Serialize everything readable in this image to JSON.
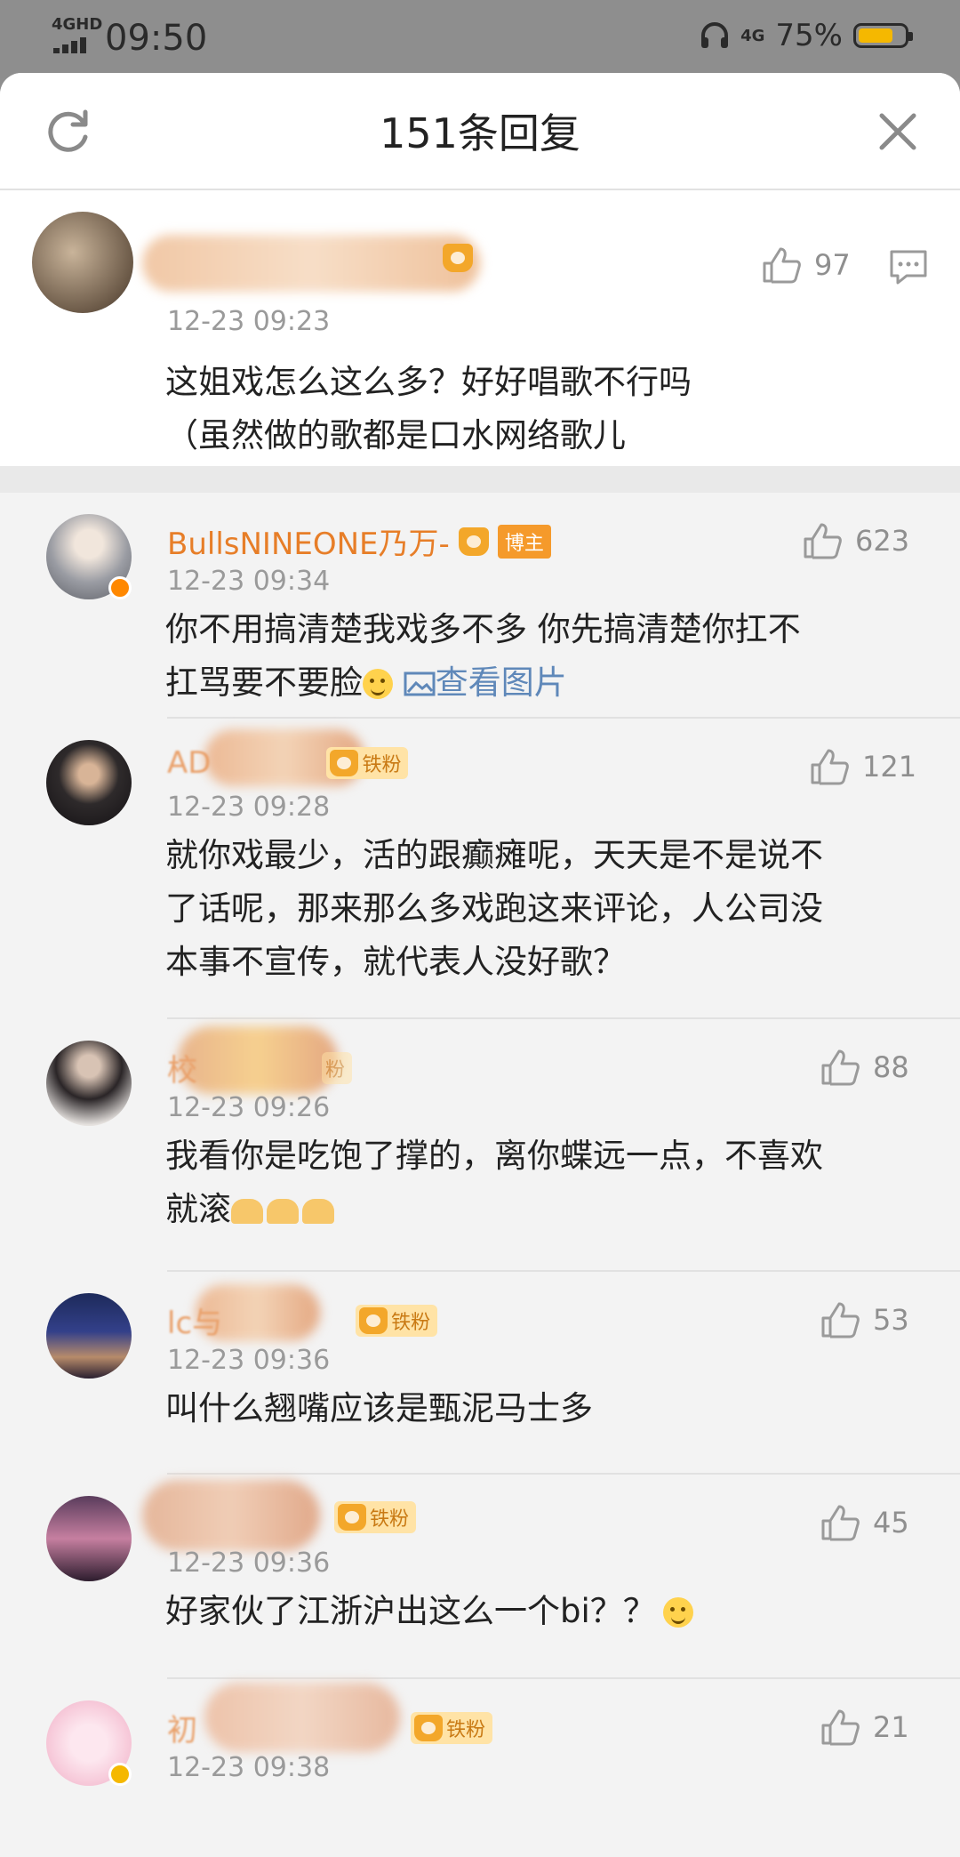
{
  "status_bar": {
    "network": "4GHD",
    "time": "09:50",
    "right_network": "4G",
    "battery": "75%",
    "battery_level": 0.75
  },
  "header": {
    "title": "151条回复"
  },
  "main_comment": {
    "time": "12-23 09:23",
    "likes": "97",
    "text_line1": "这姐戏怎么这么多？好好唱歌不行吗",
    "text_line2": "（虽然做的歌都是口水网络歌儿"
  },
  "replies": [
    {
      "username": "BullsNINEONE乃万-",
      "badge": "博主",
      "time": "12-23 09:34",
      "likes": "623",
      "text_line1": "你不用搞清楚我戏多不多 你先搞清楚你扛不",
      "text_line2": "扛骂要不要脸",
      "link": "查看图片"
    },
    {
      "username": "AD",
      "badge": "铁粉",
      "time": "12-23 09:28",
      "likes": "121",
      "text_line1": "就你戏最少，活的跟癫瘫呢，天天是不是说不",
      "text_line2": "了话呢，那来那么多戏跑这来评论，人公司没",
      "text_line3": "本事不宣传，就代表人没好歌？"
    },
    {
      "username": "校",
      "badge": "粉",
      "time": "12-23 09:26",
      "likes": "88",
      "text_line1": "我看你是吃饱了撑的，离你蝶远一点，不喜欢",
      "text_line2": "就滚"
    },
    {
      "username": "lc与",
      "badge": "铁粉",
      "time": "12-23 09:36",
      "likes": "53",
      "text_line1": "叫什么翘嘴应该是甄泥马士多"
    },
    {
      "username": "",
      "badge": "铁粉",
      "time": "12-23 09:36",
      "likes": "45",
      "text_line1": "好家伙了江浙沪出这么一个bi？？"
    },
    {
      "username": "初",
      "badge": "铁粉",
      "time": "12-23 09:38",
      "likes": "21"
    }
  ]
}
